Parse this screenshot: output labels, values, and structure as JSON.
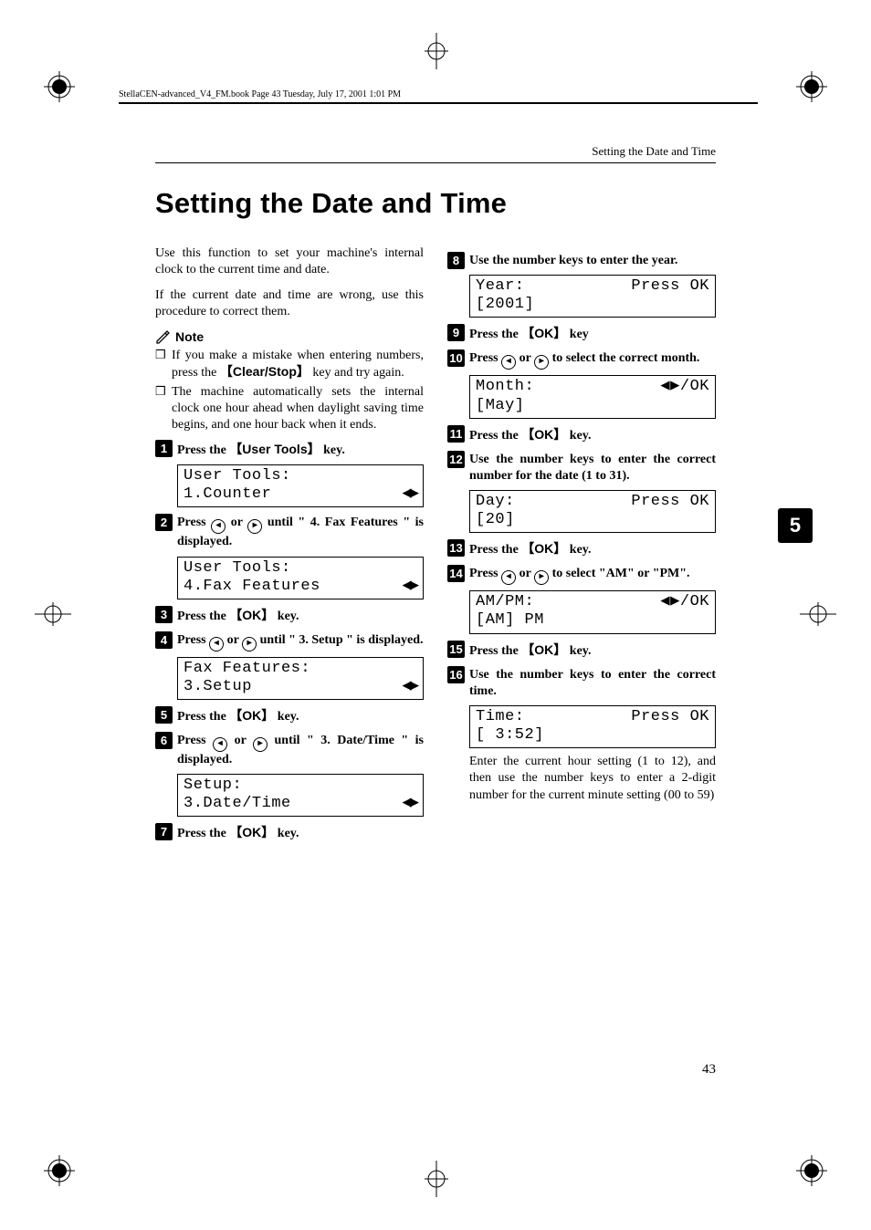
{
  "meta": {
    "book_header": "StellaCEN-advanced_V4_FM.book  Page 43  Tuesday, July 17, 2001  1:01 PM",
    "running_head": "Setting the Date and Time",
    "chapter_tab": "5",
    "page_number": "43"
  },
  "title": "Setting the Date and Time",
  "intro": [
    "Use this function to set your machine's internal clock to the current time and date.",
    "If the current date and time are wrong, use this procedure to correct them."
  ],
  "note": {
    "label": "Note",
    "items": [
      {
        "pre": "If you make a mistake when entering numbers, press the ",
        "key": "Clear/Stop",
        "post": " key and try again."
      },
      {
        "text": "The machine automatically sets the internal clock one hour ahead when daylight saving time begins, and one hour back when it ends."
      }
    ]
  },
  "key_labels": {
    "user_tools": "User Tools",
    "ok": "OK",
    "clear_stop": "Clear/Stop"
  },
  "steps_left": [
    {
      "n": "1",
      "pre": "Press the ",
      "key": "User Tools",
      "post": " key."
    },
    {
      "lcd": {
        "l1": "User Tools:",
        "r1": "",
        "l2": "1.Counter",
        "r2": "◀▶"
      }
    },
    {
      "n": "2",
      "text_html": "Press <span class='circ-arrow'>◂</span> or <span class='circ-arrow'>▸</span> until \" 4. Fax Features \" is displayed."
    },
    {
      "lcd": {
        "l1": "User Tools:",
        "r1": "",
        "l2": "4.Fax Features",
        "r2": "◀▶"
      }
    },
    {
      "n": "3",
      "pre": "Press the ",
      "key": "OK",
      "post": " key."
    },
    {
      "n": "4",
      "text_html": "Press <span class='circ-arrow'>◂</span> or <span class='circ-arrow'>▸</span> until \" 3. Setup \" is displayed."
    },
    {
      "lcd": {
        "l1": "Fax Features:",
        "r1": "",
        "l2": "3.Setup",
        "r2": "◀▶"
      }
    },
    {
      "n": "5",
      "pre": "Press the ",
      "key": "OK",
      "post": " key."
    },
    {
      "n": "6",
      "text_html": "Press <span class='circ-arrow'>◂</span> or <span class='circ-arrow'>▸</span> until \" 3. Date/Time \" is displayed."
    },
    {
      "lcd": {
        "l1": "Setup:",
        "r1": "",
        "l2": "3.Date/Time",
        "r2": "◀▶"
      }
    },
    {
      "n": "7",
      "pre": "Press the ",
      "key": "OK",
      "post": " key."
    }
  ],
  "steps_right": [
    {
      "n": "8",
      "text": "Use the number keys to enter the year."
    },
    {
      "lcd": {
        "l1": "Year:",
        "r1": "Press OK",
        "l2": "[2001]",
        "r2": ""
      }
    },
    {
      "n": "9",
      "pre": " Press the ",
      "key": "OK",
      "post": " key"
    },
    {
      "n": "10",
      "text_html": "Press <span class='circ-arrow'>◂</span> or <span class='circ-arrow'>▸</span> to select the correct month."
    },
    {
      "lcd": {
        "l1": "Month:",
        "r1": "◀▶/OK",
        "l2": "[May]",
        "r2": ""
      }
    },
    {
      "n": "11",
      "pre": "Press the ",
      "key": "OK",
      "post": " key."
    },
    {
      "n": "12",
      "text": "Use the number keys to enter the correct number for the date (1 to 31)."
    },
    {
      "lcd": {
        "l1": "Day:",
        "r1": "Press OK",
        "l2": "[20]",
        "r2": ""
      }
    },
    {
      "n": "13",
      "pre": "Press the ",
      "key": "OK",
      "post": " key."
    },
    {
      "n": "14",
      "text_html": "Press <span class='circ-arrow'>◂</span> or <span class='circ-arrow'>▸</span> to select \"AM\" or \"PM\"."
    },
    {
      "lcd": {
        "l1": "AM/PM:",
        "r1": "◀▶/OK",
        "l2": " [AM]   PM",
        "r2": ""
      }
    },
    {
      "n": "15",
      "pre": "Press the ",
      "key": "OK",
      "post": " key."
    },
    {
      "n": "16",
      "text": "Use the number keys to enter the correct time."
    },
    {
      "lcd": {
        "l1": "Time:",
        "r1": "Press OK",
        "l2": "[ 3:52]",
        "r2": ""
      }
    },
    {
      "after": "Enter the current hour setting (1 to 12), and then use the number keys to enter a 2-digit number for the current minute setting (00 to 59)"
    }
  ]
}
